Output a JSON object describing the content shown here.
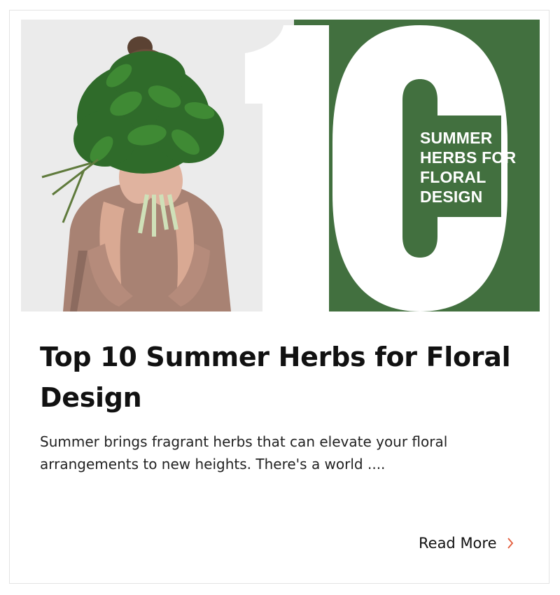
{
  "post": {
    "image": {
      "big_number": "10",
      "badge_text": "SUMMER\nHERBS FOR\nFLORAL\nDESIGN"
    },
    "title": "Top 10 Summer Herbs for Floral Design",
    "excerpt": "Summer brings fragrant herbs that can elevate your floral arrangements to new heights. There's a world ....",
    "read_more_label": "Read More",
    "read_more_icon": "chevron-right-icon"
  },
  "colors": {
    "brand_green": "#42703f",
    "accent": "#e35b3a",
    "text": "#111111"
  }
}
